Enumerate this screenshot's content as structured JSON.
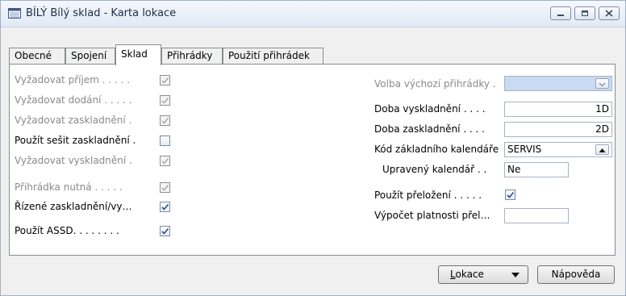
{
  "window": {
    "title": "BÍLÝ Bílý sklad - Karta lokace"
  },
  "tabs": [
    {
      "label": "Obecné"
    },
    {
      "label": "Spojení"
    },
    {
      "label": "Sklad"
    },
    {
      "label": "Přihrádky"
    },
    {
      "label": "Použití přihrádek"
    }
  ],
  "left_fields": [
    {
      "label": "Vyžadovat příjem . . . . .",
      "checked": true,
      "enabled": false
    },
    {
      "label": "Vyžadovat dodání . . . . .",
      "checked": true,
      "enabled": false
    },
    {
      "label": "Vyžadovat zaskladnění  .",
      "checked": true,
      "enabled": false
    },
    {
      "label": "Použít sešit zaskladnění  .",
      "checked": false,
      "enabled": true
    },
    {
      "label": "Vyžadovat vyskladnění  .",
      "checked": true,
      "enabled": false
    },
    {
      "label": "Přihrádka nutná . . . . .",
      "checked": true,
      "enabled": false
    },
    {
      "label": "Řízené zaskladnění/vy…",
      "checked": true,
      "enabled": true
    },
    {
      "label": "Použít ASSD. . . . . . . .",
      "checked": true,
      "enabled": true
    }
  ],
  "right_fields": {
    "default_bin_label": "Volba výchozí přihrádky  .",
    "default_bin_value": "",
    "outbound_time_label": "Doba vyskladnění . . . .",
    "outbound_time_value": "1D",
    "inbound_time_label": "Doba zaskladnění . . . .",
    "inbound_time_value": "2D",
    "base_calendar_label": "Kód základního kalendáře",
    "base_calendar_value": "SERVIS",
    "custom_calendar_label": "Upravený kalendář  . .",
    "custom_calendar_value": "Ne",
    "use_crossdock_label": "Použít přeložení . . . . .",
    "use_crossdock_checked": true,
    "crossdock_calc_label": "Výpočet platnosti přel…",
    "crossdock_calc_value": ""
  },
  "buttons": {
    "location_underline": "L",
    "location_rest": "okace",
    "help": "Nápověda"
  },
  "colors": {
    "disabled_field": "#c9daf3",
    "disabled_text": "#8a8a8a"
  }
}
